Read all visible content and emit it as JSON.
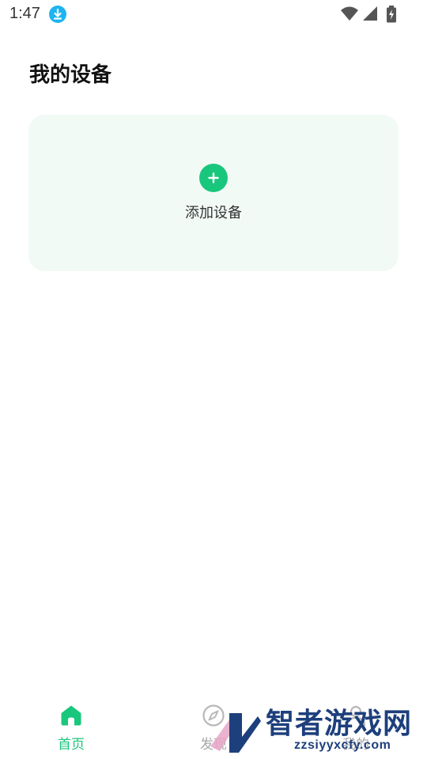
{
  "status_bar": {
    "time": "1:47",
    "download_icon": "download-icon",
    "wifi_icon": "wifi-icon",
    "signal_icon": "signal-icon",
    "battery_icon": "battery-charging-icon"
  },
  "page": {
    "title": "我的设备"
  },
  "device_card": {
    "add_icon": "plus-circle-icon",
    "add_label": "添加设备"
  },
  "bottom_nav": {
    "items": [
      {
        "label": "首页",
        "icon": "home-icon",
        "active": true
      },
      {
        "label": "发现",
        "icon": "compass-icon",
        "active": false
      },
      {
        "label": "我的",
        "icon": "user-icon",
        "active": false
      }
    ]
  },
  "watermark": {
    "title": "智者游戏网",
    "url": "zzsiyyxcfy.com"
  },
  "colors": {
    "accent": "#19c77c",
    "card_bg": "#f2faf6",
    "inactive": "#a8a8a8",
    "download_badge": "#1eb4f0"
  }
}
